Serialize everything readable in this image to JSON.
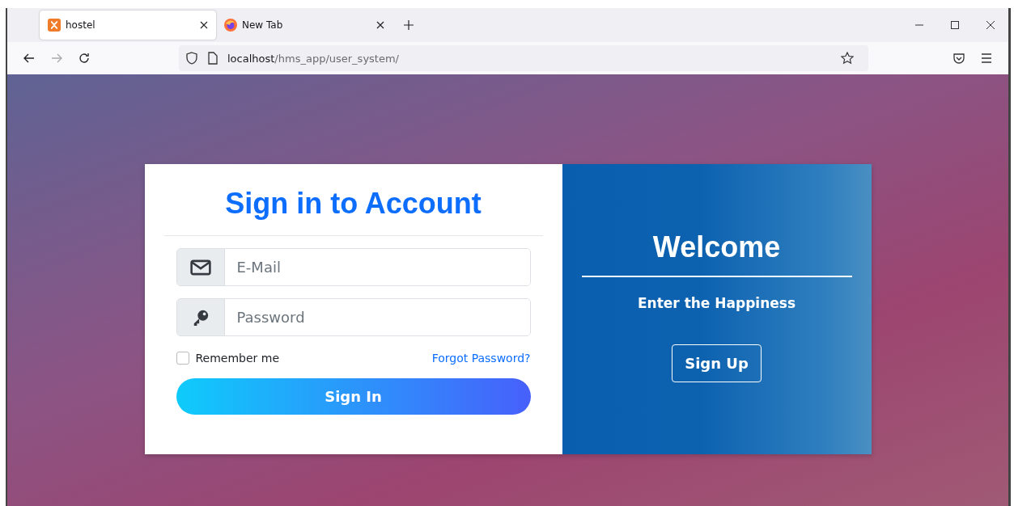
{
  "tabs": [
    {
      "title": "hostel",
      "selected": true,
      "kind": "site"
    },
    {
      "title": "New Tab",
      "selected": false,
      "kind": "newtab"
    }
  ],
  "address_bar": {
    "host": "localhost",
    "path": "/hms_app/user_system/"
  },
  "login": {
    "title": "Sign in to Account",
    "email": {
      "placeholder": "E-Mail"
    },
    "password": {
      "placeholder": "Password"
    },
    "remember": {
      "label": "Remember me",
      "checked": false
    },
    "forgot_link": "Forgot Password?",
    "submit": "Sign In"
  },
  "welcome": {
    "title": "Welcome",
    "subtitle": "Enter the Happiness",
    "button": "Sign Up"
  }
}
